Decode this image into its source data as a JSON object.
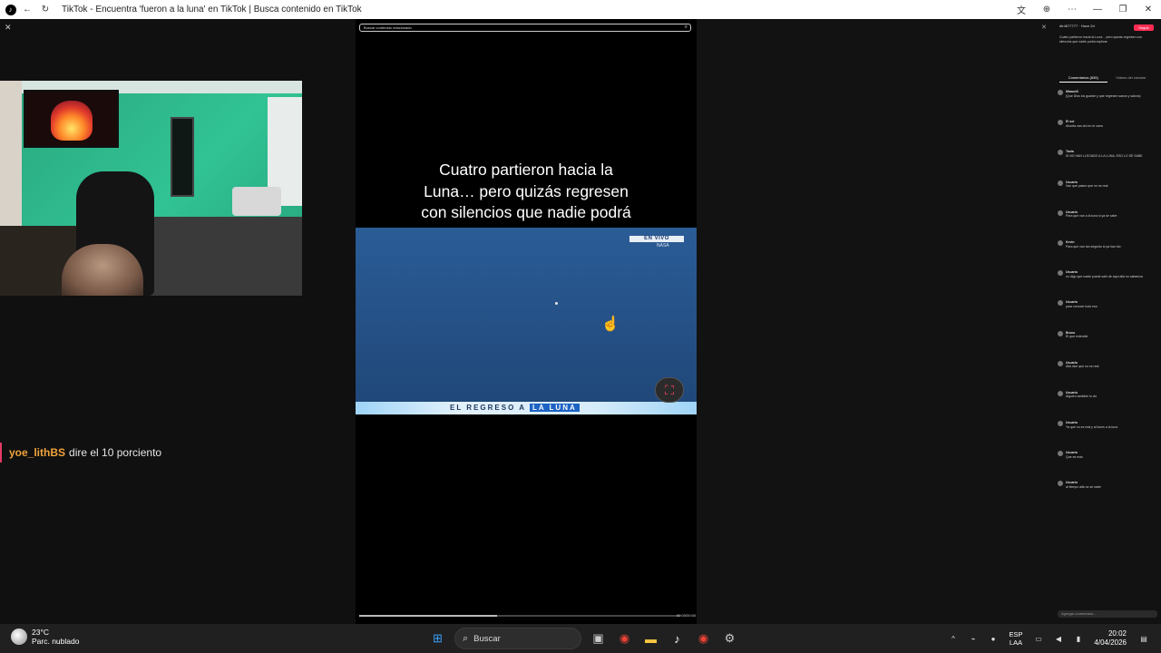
{
  "window": {
    "title": "TikTok - Encuentra 'fueron a la luna' en TikTok | Busca contenido en TikTok"
  },
  "left_panel": {
    "chat_message": {
      "user": "yoe_lithBS",
      "text": "dire el 10 porciento"
    }
  },
  "video": {
    "search_placeholder": "Buscar contenido relacionado",
    "caption": "Cuatro partieron hacia la Luna… pero quizás regresen con silencios que nadie podrá explicar.",
    "live_badge": "EN VIVO",
    "source_logo": "NASA",
    "lower_third_prefix": "EL REGRESO A",
    "lower_third_highlight": "LA LUNA",
    "progress_fraction": 0.43,
    "time_label": "00:00/00:00"
  },
  "comments_panel": {
    "author": "dtr4677777 · Hace 2d",
    "follow_label": "Seguir",
    "tabs": [
      "Comentarios (835)",
      "Videos del creador"
    ],
    "active_tab": 0,
    "comments": [
      {
        "user": "Miaau43",
        "text": "(Que Dios los guarde y que regresen sanos y salvos)"
      },
      {
        "user": "El sol",
        "text": "Ahorita van ahí en el carro"
      },
      {
        "user": "Tania",
        "text": "SI NO HAN LLEGADO A LA LUNA, ESO LO SE SABE"
      },
      {
        "user": "Usuario",
        "text": "Van que paseo que no es real"
      },
      {
        "user": "Usuario",
        "text": "Para que van a la luna si ya se sabe"
      },
      {
        "user": "Kevin",
        "text": "Para que van tan seguido si ya han ido"
      },
      {
        "user": "Usuario",
        "text": "no digo que nadie puede salir de aquí allá no sabemos"
      },
      {
        "user": "Usuario",
        "text": "para conocer todo eso"
      },
      {
        "user": "Bruno",
        "text": "El que entendió"
      },
      {
        "user": "Usuario",
        "text": "Allá dice que no es real"
      },
      {
        "user": "Usuario",
        "text": "Alguien también lo vio"
      },
      {
        "user": "Usuario",
        "text": "Ya que no es real y al lunes a la luna"
      },
      {
        "user": "Usuario",
        "text": "Que es esto"
      },
      {
        "user": "Usuario",
        "text": "al tiempo allá no se sabe"
      }
    ],
    "input_placeholder": "Agregar comentario..."
  },
  "taskbar": {
    "temperature": "23°C",
    "condition": "Parc. nublado",
    "search_label": "Buscar",
    "lang_line1": "ESP",
    "lang_line2": "LAA",
    "time": "20:02",
    "date": "4/04/2026"
  },
  "colors": {
    "accent_pink": "#fe2c55",
    "chat_user": "#f0a33b",
    "news_blue": "#2a5c96"
  }
}
